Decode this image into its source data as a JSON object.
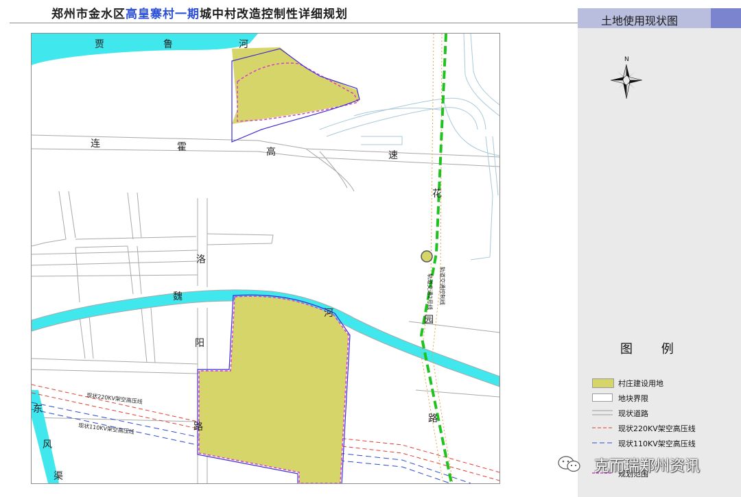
{
  "header": {
    "title_prefix": "郑州市金水区",
    "title_highlight": "高皇寨村一期",
    "title_suffix": "城中村改造控制性详细规划"
  },
  "panel": {
    "title": "土地使用现状图",
    "north_label": "N",
    "legend_title": "图 例",
    "legend": [
      {
        "label": "村庄建设用地",
        "color": "#d6d56a"
      },
      {
        "label": "地块界限",
        "color": "#9a9a9a"
      },
      {
        "label": "现状道路",
        "color": "#9a9a9a"
      },
      {
        "label": "现状220KV架空高压线",
        "color": "#e23b2e"
      },
      {
        "label": "现状110KV架空高压线",
        "color": "#2a4ad0"
      },
      {
        "label": "规划范围",
        "color": "#d43bd4"
      }
    ]
  },
  "map": {
    "labels": {
      "river_north": [
        "贾",
        "鲁",
        "河"
      ],
      "highway": [
        "连",
        "霍",
        "高",
        "速"
      ],
      "street_luoyang": [
        "洛",
        "阳",
        "路"
      ],
      "river_wei": [
        "魏",
        "河"
      ],
      "street_huayuan": [
        "花",
        "园",
        "路"
      ],
      "canal": [
        "东",
        "风",
        "渠"
      ],
      "rail_line": "轨道交通2号线",
      "rail_control": "轨道交通控制线",
      "power_220": "现状220KV架空高压线",
      "power_110": "现状110KV架空高压线"
    },
    "colors": {
      "water": "#40e8ee",
      "village_land": "#d6d56a",
      "planning_boundary": "#d43bd4",
      "parcel_boundary": "#3b2bd0",
      "rail": "#1fc21f",
      "road_edge": "#a8a8a8"
    }
  },
  "watermark": {
    "text": "克而瑞郑州资讯"
  }
}
